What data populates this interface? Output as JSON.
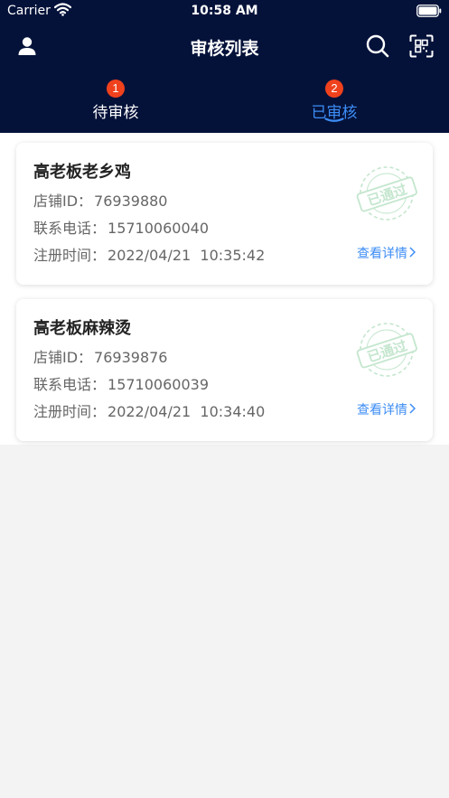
{
  "status_bar": {
    "carrier": "Carrier",
    "time": "10:58 AM"
  },
  "nav": {
    "title": "审核列表"
  },
  "tabs": [
    {
      "label": "待审核",
      "badge": "1",
      "active": false
    },
    {
      "label": "已审核",
      "badge": "2",
      "active": true
    }
  ],
  "colors": {
    "header_bg": "#04123a",
    "accent": "#3d8df5",
    "badge": "#f0411d",
    "stamp": "#3fae5f"
  },
  "cards": [
    {
      "name": "高老板老乡鸡",
      "id_label": "店铺ID：",
      "id_value": "76939880",
      "phone_label": "联系电话：",
      "phone_value": "15710060040",
      "time_label": "注册时间：",
      "time_value": "2022/04/21  10:35:42",
      "detail_label": "查看详情",
      "stamp_text": "已通过"
    },
    {
      "name": "高老板麻辣烫",
      "id_label": "店铺ID：",
      "id_value": "76939876",
      "phone_label": "联系电话：",
      "phone_value": "15710060039",
      "time_label": "注册时间：",
      "time_value": "2022/04/21  10:34:40",
      "detail_label": "查看详情",
      "stamp_text": "已通过"
    }
  ]
}
